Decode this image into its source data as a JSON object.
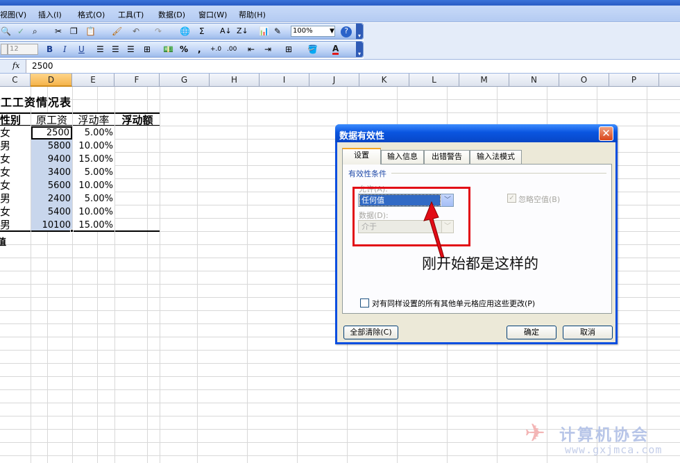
{
  "menu": [
    "视图(V)",
    "插入(I)",
    "格式(O)",
    "工具(T)",
    "数据(D)",
    "窗口(W)",
    "帮助(H)"
  ],
  "toolbar": {
    "zoom": "100%",
    "font_size": "12",
    "bold": "B",
    "italic": "I",
    "underline": "U",
    "percent": "%",
    "comma": ",",
    "sigma": "Σ",
    "help": "?",
    "font_color_glyph": "A"
  },
  "formula_bar": {
    "fx": "fx",
    "value": "2500"
  },
  "columns": [
    "C",
    "D",
    "E",
    "F",
    "G",
    "H",
    "I",
    "J",
    "K",
    "L",
    "M",
    "N",
    "O",
    "P"
  ],
  "active_column": "D",
  "sheet": {
    "title_fragment": "员工工资情况表",
    "headers": {
      "gender": "性别",
      "base_salary": "原工资",
      "float_rate": "浮动率",
      "float_amount": "浮动额"
    },
    "rows": [
      {
        "gender": "女",
        "salary": "2500",
        "rate": "5.00%"
      },
      {
        "gender": "男",
        "salary": "5800",
        "rate": "10.00%"
      },
      {
        "gender": "女",
        "salary": "9400",
        "rate": "15.00%"
      },
      {
        "gender": "女",
        "salary": "3400",
        "rate": "5.00%"
      },
      {
        "gender": "女",
        "salary": "5600",
        "rate": "10.00%"
      },
      {
        "gender": "男",
        "salary": "2400",
        "rate": "5.00%"
      },
      {
        "gender": "女",
        "salary": "5400",
        "rate": "10.00%"
      },
      {
        "gender": "男",
        "salary": "10100",
        "rate": "15.00%"
      }
    ],
    "footer_fragment": "值"
  },
  "dialog": {
    "title": "数据有效性",
    "tabs": [
      "设置",
      "输入信息",
      "出错警告",
      "输入法模式"
    ],
    "active_tab": "设置",
    "group_label": "有效性条件",
    "allow_label": "允许(A):",
    "allow_value": "任何值",
    "data_label": "数据(D):",
    "data_value": "介于",
    "ignore_blank": "忽略空值(B)",
    "ignore_blank_checked": true,
    "apply_all": "对有同样设置的所有其他单元格应用这些更改(P)",
    "apply_all_checked": false,
    "clear_all": "全部清除(C)",
    "ok": "确定",
    "cancel": "取消",
    "close_glyph": "✕"
  },
  "annotation": "刚开始都是这样的",
  "watermark": {
    "title": "计算机协会",
    "url": "www.gxjmca.com",
    "logo_glyph": "✈"
  },
  "colors": {
    "highlight_box": "#e20c16",
    "selection": "#c8d6ec",
    "xp_title": "#0a55e0"
  }
}
